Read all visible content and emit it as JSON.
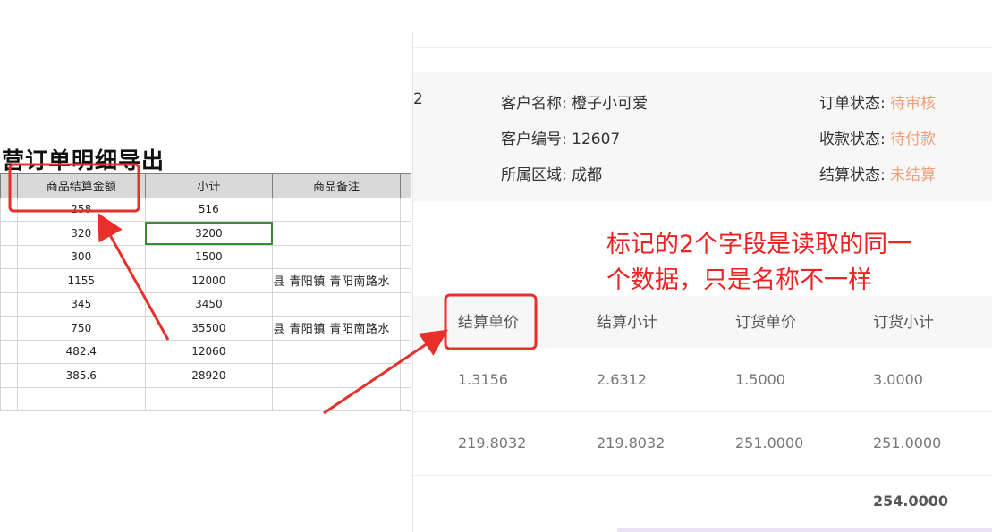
{
  "sheet": {
    "title": "营订单明细导出",
    "headers": [
      "商品结算金额",
      "小计",
      "商品备注"
    ],
    "rows": [
      {
        "amount": "258",
        "subtotal": "516",
        "note": ""
      },
      {
        "amount": "320",
        "subtotal": "3200",
        "note": ""
      },
      {
        "amount": "300",
        "subtotal": "1500",
        "note": ""
      },
      {
        "amount": "1155",
        "subtotal": "12000",
        "note": "县 青阳镇 青阳南路水"
      },
      {
        "amount": "345",
        "subtotal": "3450",
        "note": ""
      },
      {
        "amount": "750",
        "subtotal": "35500",
        "note": "县 青阳镇 青阳南路水"
      },
      {
        "amount": "482.4",
        "subtotal": "12060",
        "note": ""
      },
      {
        "amount": "385.6",
        "subtotal": "28920",
        "note": ""
      },
      {
        "amount": "",
        "subtotal": "",
        "note": ""
      }
    ]
  },
  "detail": {
    "cut_text": "2",
    "customer_name_label": "客户名称:",
    "customer_name": "橙子小可爱",
    "customer_no_label": "客户编号:",
    "customer_no": "12607",
    "region_label": "所属区域:",
    "region": "成都",
    "order_status_label": "订单状态:",
    "order_status": "待审核",
    "payment_status_label": "收款状态:",
    "payment_status": "待付款",
    "settle_status_label": "结算状态:",
    "settle_status": "未结算",
    "columns": [
      "结算单价",
      "结算小计",
      "订货单价",
      "订货小计"
    ],
    "rows": [
      [
        "1.3156",
        "2.6312",
        "1.5000",
        "3.0000"
      ],
      [
        "219.8032",
        "219.8032",
        "251.0000",
        "251.0000"
      ]
    ],
    "total": "254.0000",
    "status_color": "#f0a07a"
  },
  "annotation": {
    "text_line1": "标记的2个字段是读取的同一",
    "text_line2": "个数据，只是名称不一样",
    "color": "#ee2222"
  }
}
